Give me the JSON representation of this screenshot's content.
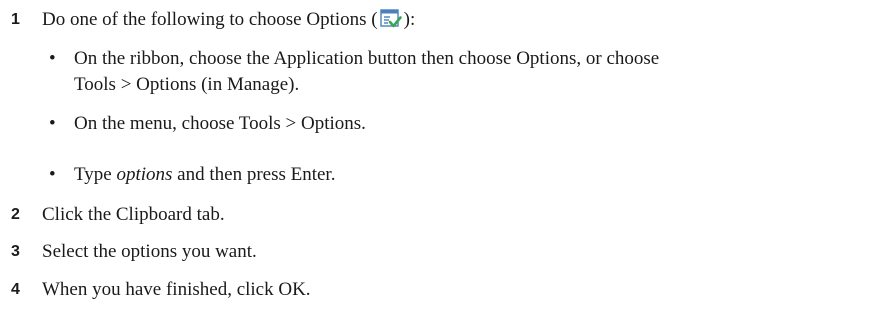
{
  "steps": [
    {
      "number": "1",
      "text_before_icon": "Do one of the following to choose Options (",
      "text_after_icon": "):",
      "icon": "options-icon",
      "substeps": [
        {
          "line1": "On the ribbon, choose the Application button then choose Options, or choose",
          "line2": "Tools > Options (in Manage)."
        },
        {
          "text": "On the menu, choose Tools > Options."
        },
        {
          "prefix": "Type ",
          "italic": "options",
          "suffix": " and then press Enter."
        }
      ]
    },
    {
      "number": "2",
      "text": "Click the Clipboard tab."
    },
    {
      "number": "3",
      "text": "Select the options you want."
    },
    {
      "number": "4",
      "text": "When you have finished, click OK."
    }
  ],
  "bullet_glyph": "•",
  "colors": {
    "text": "#1a1a1a",
    "icon_frame": "#4a7fc1",
    "icon_check": "#3aa655"
  }
}
